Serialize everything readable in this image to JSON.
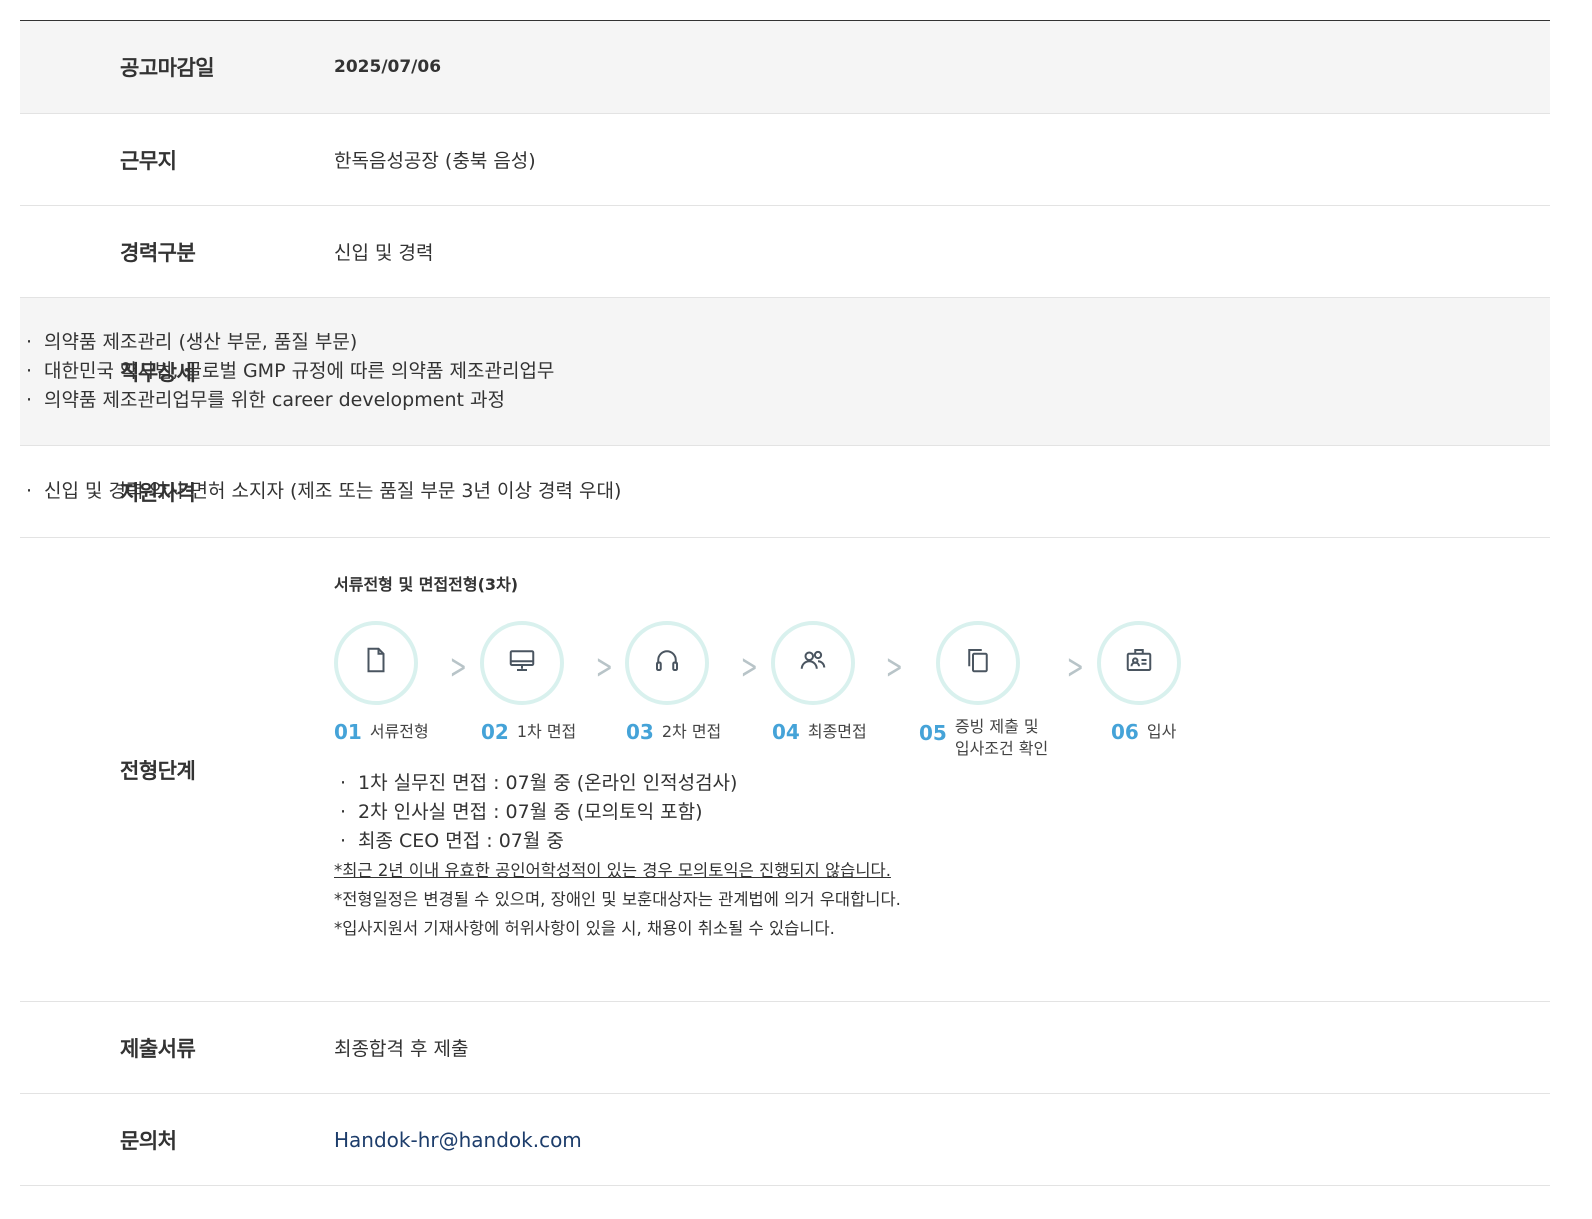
{
  "rows": {
    "deadline": {
      "label": "공고마감일",
      "value": "2025/07/06"
    },
    "location": {
      "label": "근무지",
      "value": "한독음성공장 (충북 음성)"
    },
    "career": {
      "label": "경력구분",
      "value": "신입 및 경력"
    },
    "duty": {
      "label": "직무상세",
      "items": [
        "의약품 제조관리 (생산 부문, 품질 부문)",
        "대한민국 약사법, 글로벌 GMP 규정에 따른 의약품 제조관리업무",
        "의약품 제조관리업무를 위한 career development 과정"
      ]
    },
    "qualification": {
      "label": "지원자격",
      "items": [
        "신입 및 경력 약사 면허 소지자 (제조 또는 품질 부문 3년 이상 경력 우대)"
      ]
    },
    "process": {
      "label": "전형단계",
      "title": "서류전형 및 면접전형(3차)",
      "steps": [
        {
          "num": "01",
          "text": "서류전형",
          "icon": "document-icon"
        },
        {
          "num": "02",
          "text": "1차 면접",
          "icon": "monitor-icon"
        },
        {
          "num": "03",
          "text": "2차 면접",
          "icon": "headset-icon"
        },
        {
          "num": "04",
          "text": "최종면접",
          "icon": "people-icon"
        },
        {
          "num": "05",
          "text": "증빙 제출 및",
          "text2": "입사조건 확인",
          "icon": "copy-icon"
        },
        {
          "num": "06",
          "text": "입사",
          "icon": "id-card-icon"
        }
      ],
      "items": [
        "1차 실무진 면접 : 07월 중 (온라인 인적성검사)",
        "2차 인사실 면접 : 07월 중 (모의토익 포함)",
        "최종 CEO 면접 : 07월 중"
      ],
      "notes": [
        "*최근 2년 이내 유효한 공인어학성적이 있는 경우 모의토익은 진행되지 않습니다.",
        "*전형일정은 변경될 수 있으며, 장애인 및 보훈대상자는 관계법에 의거 우대합니다.",
        "*입사지원서 기재사항에 허위사항이 있을 시, 채용이 취소될 수 있습니다."
      ]
    },
    "documents": {
      "label": "제출서류",
      "value": "최종합격 후 제출"
    },
    "contact": {
      "label": "문의처",
      "value": "Handok-hr@handok.com"
    }
  },
  "colors": {
    "step_number": "#45a3d8",
    "circle_border": "#d9f1ee",
    "icon": "#4a5560",
    "email": "#1d3d6b"
  }
}
